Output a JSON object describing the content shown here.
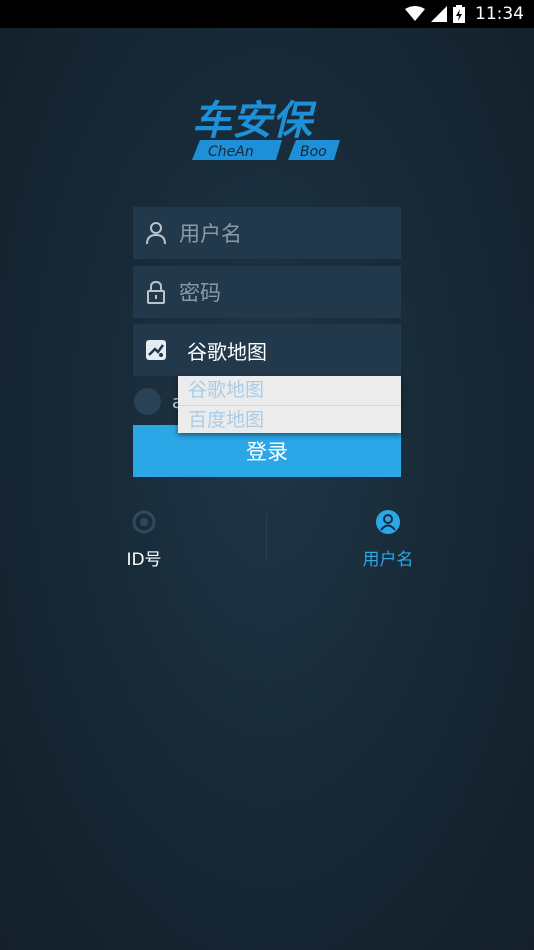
{
  "status_bar": {
    "time": "11:34"
  },
  "logo": {
    "cn_text": "车安保",
    "en_left": "CheAn",
    "en_right": "Boo"
  },
  "form": {
    "username_placeholder": "用户名",
    "password_placeholder": "密码",
    "map_selected": "谷歌地图",
    "map_options": [
      "谷歌地图",
      "百度地图"
    ],
    "remember_partial": "a",
    "login_label": "登录"
  },
  "tabs": [
    {
      "label": "ID号",
      "icon": "id-badge-icon",
      "active": false
    },
    {
      "label": "用户名",
      "icon": "user-circle-icon",
      "active": true
    }
  ],
  "colors": {
    "accent": "#2aa7e7",
    "field_bg": "#22394b",
    "background": "#182a38"
  }
}
